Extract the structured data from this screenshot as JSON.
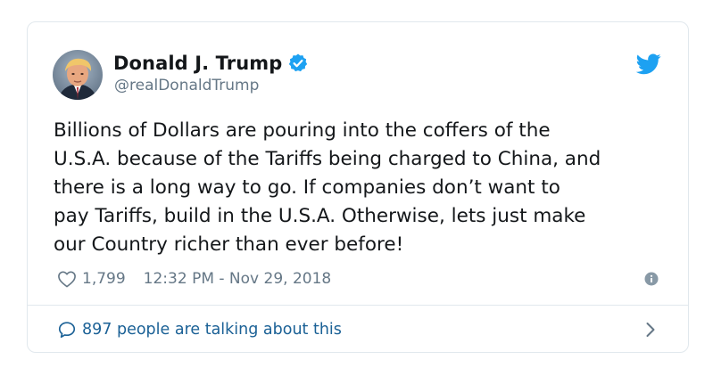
{
  "author": {
    "name": "Donald J. Trump",
    "handle": "@realDonaldTrump",
    "verified": true
  },
  "icons": {
    "verified": "verified-badge-icon",
    "brand": "twitter-bird-icon",
    "like": "heart-icon",
    "info": "info-icon",
    "reply": "speech-bubble-icon",
    "chevron": "chevron-right-icon"
  },
  "tweet": {
    "text": "Billions of Dollars are pouring into the coffers of the\nU.S.A. because of the Tariffs being charged to China, and\nthere is a long way to go. If companies don’t want to\npay Tariffs, build in the U.S.A. Otherwise, lets just make\nour Country richer than ever before!",
    "likes": "1,799",
    "timestamp": "12:32 PM - Nov 29, 2018"
  },
  "conversation": {
    "label": "897 people are talking about this"
  },
  "colors": {
    "brand_blue": "#1da1f2",
    "link_blue": "#1b6196",
    "muted_gray": "#657786",
    "border": "#e1e8ed"
  }
}
